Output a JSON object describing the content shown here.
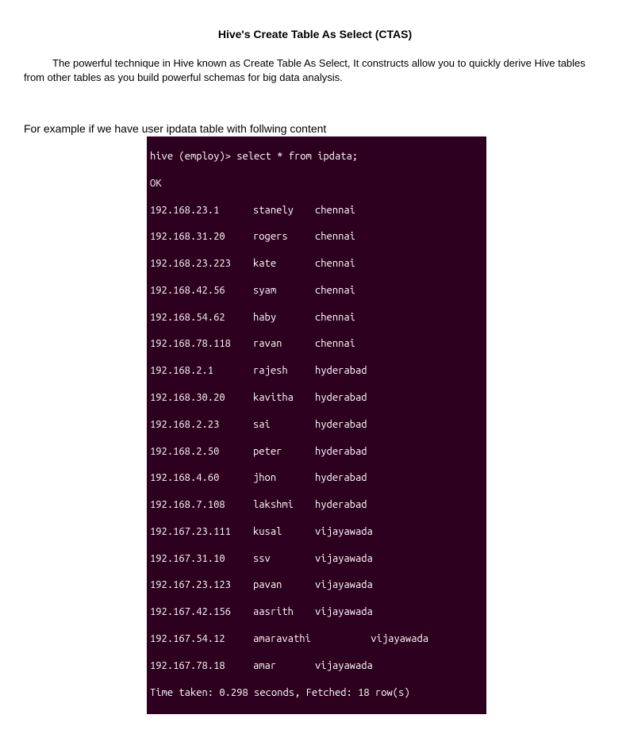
{
  "title": "Hive's Create Table As Select (CTAS)",
  "para": "The powerful technique in Hive known as Create Table As Select, It constructs allow you to quickly derive Hive tables from other tables as you build powerful schemas for big data analysis.",
  "example_lead": "For example if we have user ipdata table with follwing content",
  "terminal": {
    "prompt": "hive (employ)> select * from ipdata;",
    "ok": "OK",
    "rows": [
      {
        "ip": "192.168.23.1",
        "name": "stanely",
        "city": "chennai"
      },
      {
        "ip": "192.168.31.20",
        "name": "rogers",
        "city": "chennai"
      },
      {
        "ip": "192.168.23.223",
        "name": "kate",
        "city": "chennai"
      },
      {
        "ip": "192.168.42.56",
        "name": "syam",
        "city": "chennai"
      },
      {
        "ip": "192.168.54.62",
        "name": "haby",
        "city": "chennai"
      },
      {
        "ip": "192.168.78.118",
        "name": "ravan",
        "city": "chennai"
      },
      {
        "ip": "192.168.2.1",
        "name": "rajesh",
        "city": "hyderabad"
      },
      {
        "ip": "192.168.30.20",
        "name": "kavitha",
        "city": "hyderabad"
      },
      {
        "ip": "192.168.2.23",
        "name": "sai",
        "city": "hyderabad"
      },
      {
        "ip": "192.168.2.50",
        "name": "peter",
        "city": "hyderabad"
      },
      {
        "ip": "192.168.4.60",
        "name": "jhon",
        "city": "hyderabad"
      },
      {
        "ip": "192.168.7.108",
        "name": "lakshmi",
        "city": "hyderabad"
      },
      {
        "ip": "192.167.23.111",
        "name": "kusal",
        "city": "vijayawada"
      },
      {
        "ip": "192.167.31.10",
        "name": "ssv",
        "city": "vijayawada"
      },
      {
        "ip": "192.167.23.123",
        "name": "pavan",
        "city": "vijayawada"
      },
      {
        "ip": "192.167.42.156",
        "name": "aasrith",
        "city": "vijayawada"
      },
      {
        "ip": "192.167.54.12",
        "name": "amaravathi",
        "city": "vijayawada"
      },
      {
        "ip": "192.167.78.18",
        "name": "amar",
        "city": "vijayawada"
      }
    ],
    "footer": "Time taken: 0.298 seconds, Fetched: 18 row(s)"
  }
}
